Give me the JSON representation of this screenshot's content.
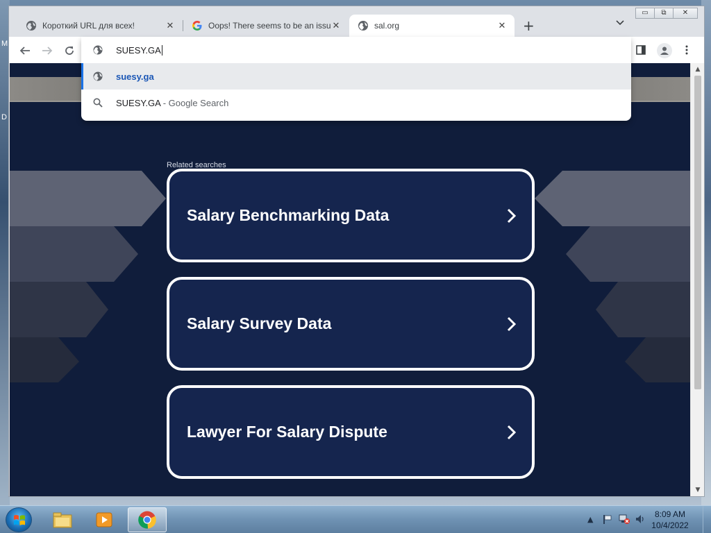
{
  "browser": {
    "tabs": [
      {
        "title": "Короткий URL для всех!",
        "active": false,
        "icon": "globe-icon"
      },
      {
        "title": "Oops! There seems to be an issue",
        "active": false,
        "icon": "google-g-icon"
      },
      {
        "title": "sal.org",
        "active": true,
        "icon": "globe-icon"
      }
    ],
    "new_tab_symbol": "+",
    "window_controls": {
      "minimize": "▭",
      "maximize": "⧉",
      "close": "✕"
    }
  },
  "omnibox": {
    "input_value": "SUESY.GA",
    "suggestions": [
      {
        "text": "suesy.ga",
        "sub": "",
        "icon": "globe-icon",
        "selected": true
      },
      {
        "text": "SUESY.GA",
        "sub": " - Google Search",
        "icon": "search-icon",
        "selected": false
      }
    ]
  },
  "page": {
    "related_label": "Related searches",
    "cards": [
      {
        "label": "Salary Benchmarking Data"
      },
      {
        "label": "Salary Survey Data"
      },
      {
        "label": "Lawyer For Salary Dispute"
      }
    ]
  },
  "desktop": {
    "left_letters": [
      "M",
      "D"
    ]
  },
  "taskbar": {
    "clock_time": "8:09 AM",
    "clock_date": "10/4/2022"
  },
  "colors": {
    "page_bg": "#101d3b",
    "card_bg": "#15254e",
    "card_border": "#ffffff",
    "accent_blue": "#1a73e8"
  }
}
